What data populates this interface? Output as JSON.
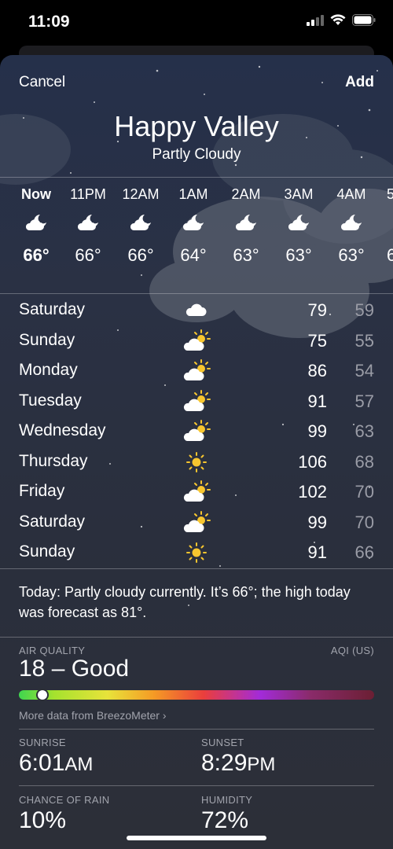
{
  "status_bar": {
    "time": "11:09"
  },
  "header": {
    "cancel": "Cancel",
    "add": "Add",
    "city": "Happy Valley",
    "condition": "Partly Cloudy"
  },
  "hourly": [
    {
      "time": "Now",
      "temp": "66°",
      "icon": "partly-cloudy-night-icon"
    },
    {
      "time": "11PM",
      "temp": "66°",
      "icon": "partly-cloudy-night-icon"
    },
    {
      "time": "12AM",
      "temp": "66°",
      "icon": "partly-cloudy-night-icon"
    },
    {
      "time": "1AM",
      "temp": "64°",
      "icon": "partly-cloudy-night-icon"
    },
    {
      "time": "2AM",
      "temp": "63°",
      "icon": "partly-cloudy-night-icon"
    },
    {
      "time": "3AM",
      "temp": "63°",
      "icon": "partly-cloudy-night-icon"
    },
    {
      "time": "4AM",
      "temp": "63°",
      "icon": "partly-cloudy-night-icon"
    },
    {
      "time": "5",
      "temp": "6",
      "icon": ""
    }
  ],
  "daily": [
    {
      "day": "Saturday",
      "icon": "cloud-icon",
      "high": "79",
      "low": "59"
    },
    {
      "day": "Sunday",
      "icon": "partly-sunny-icon",
      "high": "75",
      "low": "55"
    },
    {
      "day": "Monday",
      "icon": "partly-sunny-icon",
      "high": "86",
      "low": "54"
    },
    {
      "day": "Tuesday",
      "icon": "partly-sunny-icon",
      "high": "91",
      "low": "57"
    },
    {
      "day": "Wednesday",
      "icon": "partly-sunny-icon",
      "high": "99",
      "low": "63"
    },
    {
      "day": "Thursday",
      "icon": "sun-icon",
      "high": "106",
      "low": "68"
    },
    {
      "day": "Friday",
      "icon": "partly-sunny-icon",
      "high": "102",
      "low": "70"
    },
    {
      "day": "Saturday",
      "icon": "partly-sunny-icon",
      "high": "99",
      "low": "70"
    },
    {
      "day": "Sunday",
      "icon": "sun-icon",
      "high": "91",
      "low": "66"
    }
  ],
  "summary": "Today: Partly cloudy currently. It’s 66°; the high today was forecast as 81°.",
  "air_quality": {
    "label": "AIR QUALITY",
    "index_label": "AQI (US)",
    "value": "18 – Good",
    "aqi": 18,
    "more": "More data from BreezoMeter ›"
  },
  "details": {
    "sunrise_label": "SUNRISE",
    "sunrise_time": "6:01",
    "sunrise_period": "AM",
    "sunset_label": "SUNSET",
    "sunset_time": "8:29",
    "sunset_period": "PM",
    "rain_label": "CHANCE OF RAIN",
    "rain_value": "10%",
    "humidity_label": "HUMIDITY",
    "humidity_value": "72%"
  },
  "colors": {
    "sun": "#f7c62f",
    "low_temp": "#9a9ca6",
    "secondary": "#a2a4ad"
  }
}
